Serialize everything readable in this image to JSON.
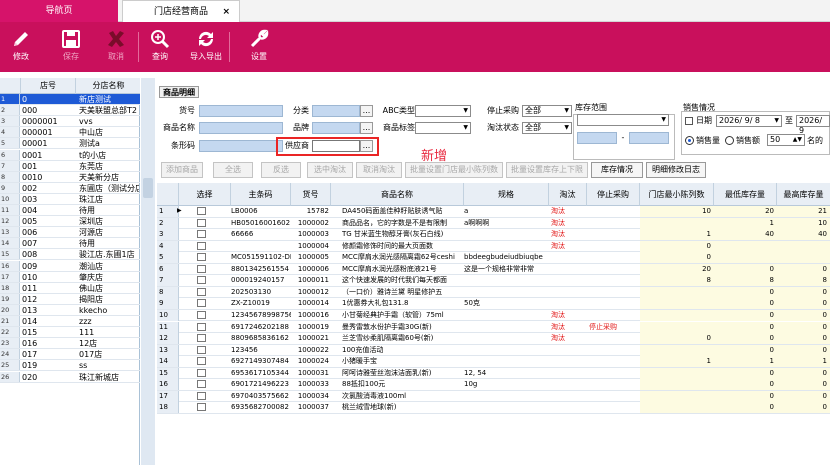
{
  "tabs": [
    {
      "label": "导航页"
    },
    {
      "label": "门店经营商品",
      "close": "×"
    }
  ],
  "toolbar": {
    "edit": "修改",
    "save": "保存",
    "cancel": "取消",
    "query": "查询",
    "import_export": "导入导出",
    "settings": "设置"
  },
  "store_list": {
    "headers": {
      "code": "店号",
      "name": "分店名称"
    },
    "rows": [
      {
        "n": "1",
        "code": "0",
        "name": "新店测试"
      },
      {
        "n": "2",
        "code": "000",
        "name": "天美联盟总部T2"
      },
      {
        "n": "3",
        "code": "0000001",
        "name": "vvs"
      },
      {
        "n": "4",
        "code": "000001",
        "name": "中山店"
      },
      {
        "n": "5",
        "code": "00001",
        "name": "测试a"
      },
      {
        "n": "6",
        "code": "0001",
        "name": "t的小店"
      },
      {
        "n": "7",
        "code": "001",
        "name": "东莞店"
      },
      {
        "n": "8",
        "code": "0010",
        "name": "天美新分店"
      },
      {
        "n": "9",
        "code": "002",
        "name": "东圃店（测试分店"
      },
      {
        "n": "10",
        "code": "003",
        "name": "珠江店"
      },
      {
        "n": "11",
        "code": "004",
        "name": "待用"
      },
      {
        "n": "12",
        "code": "005",
        "name": "深圳店"
      },
      {
        "n": "13",
        "code": "006",
        "name": "河源店"
      },
      {
        "n": "14",
        "code": "007",
        "name": "待用"
      },
      {
        "n": "15",
        "code": "008",
        "name": "骏江店.东圃1店"
      },
      {
        "n": "16",
        "code": "009",
        "name": "潮汕店"
      },
      {
        "n": "17",
        "code": "010",
        "name": "肇庆店"
      },
      {
        "n": "18",
        "code": "011",
        "name": "佛山店"
      },
      {
        "n": "19",
        "code": "012",
        "name": "揭阳店"
      },
      {
        "n": "20",
        "code": "013",
        "name": "kkecho"
      },
      {
        "n": "21",
        "code": "014",
        "name": "zzz"
      },
      {
        "n": "22",
        "code": "015",
        "name": "111"
      },
      {
        "n": "23",
        "code": "016",
        "name": "12店"
      },
      {
        "n": "24",
        "code": "017",
        "name": "017店"
      },
      {
        "n": "25",
        "code": "019",
        "name": "ss"
      },
      {
        "n": "26",
        "code": "020",
        "name": "珠江新城店"
      }
    ]
  },
  "section_title": "商品明细",
  "filters": {
    "code_label": "货号",
    "category_label": "分类",
    "abc_label": "ABC类型",
    "stop_label": "停止采购",
    "stop_value": "全部",
    "name_label": "商品名称",
    "brand_label": "品牌",
    "tag_label": "商品标签",
    "eliminate_label": "淘汰状态",
    "eliminate_value": "全部",
    "barcode_label": "条形码",
    "supplier_label": "供应商",
    "stock_range_label": "库存范围",
    "range_dash": "-",
    "sales_label": "销售情况",
    "date_label": "日期",
    "date_from": "2026/ 9/ 8",
    "date_to_label": "至",
    "date_to": "2026/ 9",
    "sales_qty": "销售量",
    "sales_amt": "销售额",
    "top_n": "50",
    "top_label": "名的",
    "dots": "...",
    "arrow": "▼",
    "spin": "▲▼"
  },
  "annotation": "新增",
  "buttons": {
    "add": "添加商品",
    "select_all": "全选",
    "invert": "反选",
    "eliminate": "选中淘汰",
    "cancel_eliminate": "取消淘汰",
    "batch_min": "批量设置门店最小陈列数",
    "batch_stock": "批量设置库存上下限",
    "stock_info": "库存情况",
    "detail_log": "明细修改日志"
  },
  "grid": {
    "headers": {
      "select": "选择",
      "barcode": "主条码",
      "code": "货号",
      "name": "商品名称",
      "spec": "规格",
      "eliminate": "淘汰",
      "stop": "停止采购",
      "min_display": "门店最小陈列数",
      "min_stock": "最低库存量",
      "max_stock": "最高库存量"
    },
    "rows": [
      {
        "n": "1",
        "code": "LB0006",
        "no": "15782",
        "name": "DA450码面盖佳种籽贴肤诱气贴",
        "spec": "a",
        "tt": "淘汰",
        "stop": "",
        "mn": "10",
        "lo": "20",
        "hi": "21"
      },
      {
        "n": "2",
        "code": "HB05016001602",
        "no": "1000002",
        "name": "商品品名，它的字数是不是有限制",
        "spec": "a啊啊啊",
        "tt": "淘汰",
        "stop": "",
        "mn": "",
        "lo": "1",
        "hi": "10"
      },
      {
        "n": "3",
        "code": "66666",
        "no": "1000003",
        "name": "TG 甘米蓝生物醇牙膏(灰石白线)",
        "spec": "",
        "tt": "淘汰",
        "stop": "",
        "mn": "1",
        "lo": "40",
        "hi": "40"
      },
      {
        "n": "4",
        "code": "",
        "no": "1000004",
        "name": "修颜霜修饰时间的最大页面数",
        "spec": "",
        "tt": "淘汰",
        "stop": "",
        "mn": "0",
        "lo": "",
        "hi": ""
      },
      {
        "n": "5",
        "code": "MC051591102-DM",
        "no": "1000005",
        "name": "MCC摩肩水润光感隔离霜62号ceshi",
        "spec": "bbdeegbudeiudbiuqbe",
        "tt": "",
        "stop": "",
        "mn": "0",
        "lo": "",
        "hi": ""
      },
      {
        "n": "6",
        "code": "8801342561554",
        "no": "1000006",
        "name": "MCC摩肩水润光感粉底液21号",
        "spec": "这是一个规格非常非常",
        "tt": "",
        "stop": "",
        "mn": "20",
        "lo": "0",
        "hi": "0"
      },
      {
        "n": "7",
        "code": "000019240157",
        "no": "1000011",
        "name": "这个快速发展的时代我们每天都面",
        "spec": "",
        "tt": "",
        "stop": "",
        "mn": "8",
        "lo": "8",
        "hi": "8"
      },
      {
        "n": "8",
        "code": "202503130",
        "no": "1000012",
        "name": "（一口价）雅诗兰黛 明星修护五",
        "spec": "",
        "tt": "",
        "stop": "",
        "mn": "",
        "lo": "0",
        "hi": "0"
      },
      {
        "n": "9",
        "code": "ZX-Z10019",
        "no": "1000014",
        "name": "1优惠券大礼包131.8",
        "spec": "50克",
        "tt": "",
        "stop": "",
        "mn": "",
        "lo": "0",
        "hi": "0"
      },
      {
        "n": "10",
        "code": "123456789987567",
        "no": "1000016",
        "name": "小甘菊经典护手霜（软管）75ml",
        "spec": "",
        "tt": "淘汰",
        "stop": "",
        "mn": "",
        "lo": "0",
        "hi": "0"
      },
      {
        "n": "11",
        "code": "6917246202188",
        "no": "1000019",
        "name": "曼秀雷敦水份护手霜30G(新)",
        "spec": "",
        "tt": "淘汰",
        "stop": "停止采购",
        "mn": "",
        "lo": "0",
        "hi": "0"
      },
      {
        "n": "12",
        "code": "8809685836162",
        "no": "1000021",
        "name": "兰芝雪纱柔肌隔离霜60号(新)",
        "spec": "",
        "tt": "淘汰",
        "stop": "",
        "mn": "0",
        "lo": "0",
        "hi": "0"
      },
      {
        "n": "13",
        "code": "123456",
        "no": "1000022",
        "name": "100充值活动",
        "spec": "",
        "tt": "",
        "stop": "",
        "mn": "",
        "lo": "0",
        "hi": "0"
      },
      {
        "n": "14",
        "code": "6927149307484",
        "no": "1000024",
        "name": "小猪暖手宝",
        "spec": "",
        "tt": "",
        "stop": "",
        "mn": "1",
        "lo": "1",
        "hi": "1"
      },
      {
        "n": "15",
        "code": "6953617105344",
        "no": "1000031",
        "name": "阿呵诗雅莹丝泡沫洁面乳(新)",
        "spec": "12, 54",
        "tt": "",
        "stop": "",
        "mn": "",
        "lo": "0",
        "hi": "0"
      },
      {
        "n": "16",
        "code": "6901721496223",
        "no": "1000033",
        "name": "88抵扣100元",
        "spec": "10g",
        "tt": "",
        "stop": "",
        "mn": "",
        "lo": "0",
        "hi": "0"
      },
      {
        "n": "17",
        "code": "6970403575662",
        "no": "1000034",
        "name": "次氯酸消毒液100ml",
        "spec": "",
        "tt": "",
        "stop": "",
        "mn": "",
        "lo": "0",
        "hi": "0"
      },
      {
        "n": "18",
        "code": "6935682700082",
        "no": "1000037",
        "name": "桃兰绒雪地球(新)",
        "spec": "",
        "tt": "",
        "stop": "",
        "mn": "",
        "lo": "0",
        "hi": "0"
      }
    ]
  }
}
